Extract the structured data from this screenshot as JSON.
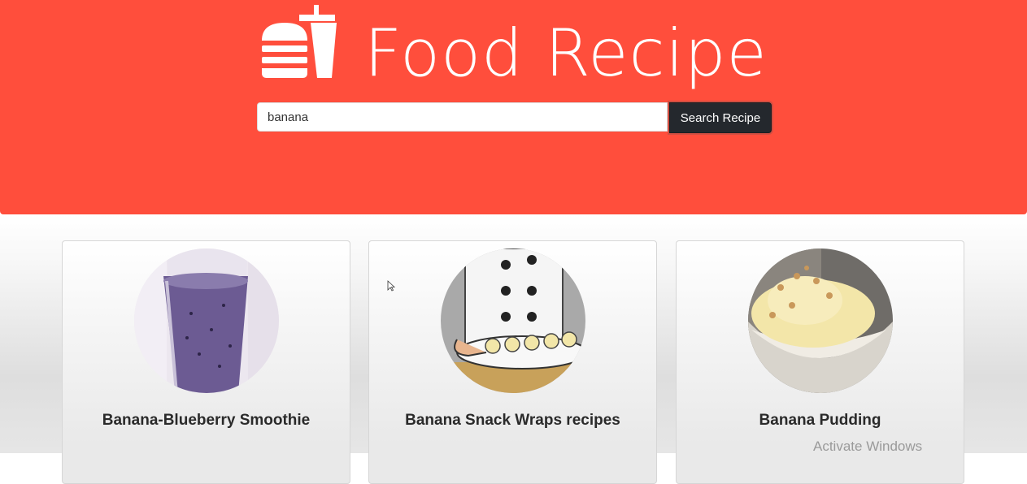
{
  "header": {
    "title": "Food Recipe",
    "logo_icon": "burger-drink-icon",
    "background_color": "#ff4e3c"
  },
  "search": {
    "value": "banana",
    "button_label": "Search Recipe"
  },
  "recipes": [
    {
      "title": "Banana-Blueberry Smoothie",
      "image_icon": "smoothie-glass-image"
    },
    {
      "title": "Banana Snack Wraps recipes",
      "image_icon": "chef-banana-tray-image"
    },
    {
      "title": "Banana Pudding",
      "image_icon": "pudding-bowl-image"
    }
  ],
  "overlay": {
    "watermark": "Activate Windows"
  }
}
